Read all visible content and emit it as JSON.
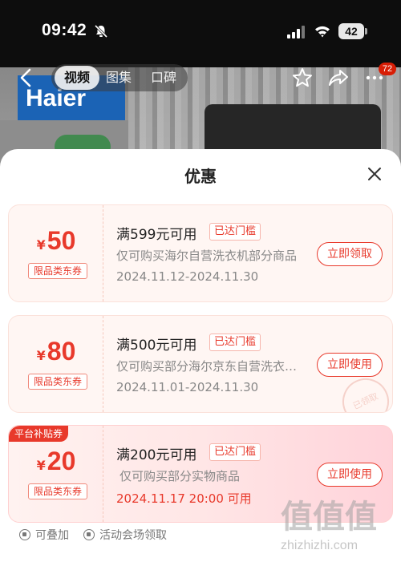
{
  "status_bar": {
    "time": "09:42",
    "battery": "42"
  },
  "nav": {
    "tabs": [
      {
        "label": "视频"
      },
      {
        "label": "图集"
      },
      {
        "label": "口碑"
      }
    ],
    "cart_badge": "72",
    "background_brand": "Haier"
  },
  "sheet": {
    "title": "优惠",
    "coupons": [
      {
        "currency": "¥",
        "amount": "50",
        "type": "限品类东券",
        "threshold": "满599元可用",
        "status_tag": "已达门槛",
        "scope": "仅可购买海尔自营洗衣机部分商品",
        "dates": "2024.11.12-2024.11.30",
        "action": "立即领取"
      },
      {
        "currency": "¥",
        "amount": "80",
        "type": "限品类东券",
        "threshold": "满500元可用",
        "status_tag": "已达门槛",
        "scope": "仅可购买部分海尔京东自营洗衣…",
        "dates": "2024.11.01-2024.11.30",
        "action": "立即使用",
        "stamp": "已领取"
      },
      {
        "corner_label": "平台补贴券",
        "currency": "¥",
        "amount": "20",
        "type": "限品类东券",
        "threshold": "满200元可用",
        "status_tag": "已达门槛",
        "scope": "仅可购买部分实物商品",
        "dates": "2024.11.17 20:00 可用",
        "action": "立即使用"
      }
    ],
    "footer": [
      {
        "label": "可叠加"
      },
      {
        "label": "活动会场领取"
      }
    ]
  },
  "watermark": {
    "text": "值值值",
    "url": "zhizhizhi.com"
  },
  "colors": {
    "accent": "#e8392b",
    "sheet_bg": "#ffffff",
    "coupon_bg": "#fff6f3"
  }
}
